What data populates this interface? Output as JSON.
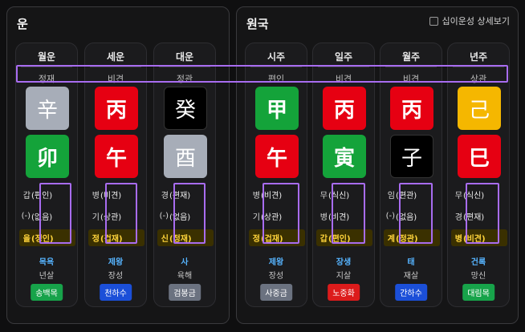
{
  "left_panel": {
    "title": "운",
    "columns": [
      {
        "header": "월운",
        "stem_god": "정재",
        "stem": "辛",
        "stem_color": "gray",
        "branch": "卯",
        "branch_color": "green",
        "hidden": [
          {
            "ch": "갑",
            "god": "(편인)"
          },
          {
            "ch": "(-)",
            "god": "(없음)"
          },
          {
            "ch": "을",
            "god": "(정인)",
            "hl": true
          }
        ],
        "stage": "목욕",
        "sal": "년살",
        "napeum": "송백목",
        "napeum_color": "green"
      },
      {
        "header": "세운",
        "stem_god": "비견",
        "stem": "丙",
        "stem_color": "red",
        "branch": "午",
        "branch_color": "red",
        "hidden": [
          {
            "ch": "병",
            "god": "(비견)"
          },
          {
            "ch": "기",
            "god": "(상관)"
          },
          {
            "ch": "정",
            "god": "(겁재)",
            "hl": true
          }
        ],
        "stage": "제왕",
        "sal": "장성",
        "napeum": "천하수",
        "napeum_color": "blue"
      },
      {
        "header": "대운",
        "stem_god": "정관",
        "stem": "癸",
        "stem_color": "black",
        "branch": "酉",
        "branch_color": "gray",
        "hidden": [
          {
            "ch": "경",
            "god": "(편재)"
          },
          {
            "ch": "(-)",
            "god": "(없음)"
          },
          {
            "ch": "신",
            "god": "(정재)",
            "hl": true
          }
        ],
        "stage": "사",
        "sal": "육해",
        "napeum": "검봉금",
        "napeum_color": "gray"
      }
    ]
  },
  "right_panel": {
    "title": "원국",
    "toggle_label": "십이운성 상세보기",
    "columns": [
      {
        "header": "시주",
        "stem_god": "편인",
        "stem": "甲",
        "stem_color": "green",
        "branch": "午",
        "branch_color": "red",
        "hidden": [
          {
            "ch": "병",
            "god": "(비견)"
          },
          {
            "ch": "기",
            "god": "(상관)"
          },
          {
            "ch": "정",
            "god": "(겁재)",
            "hl": true
          }
        ],
        "stage": "제왕",
        "sal": "장성",
        "napeum": "사중금",
        "napeum_color": "gray"
      },
      {
        "header": "일주",
        "stem_god": "비견",
        "stem": "丙",
        "stem_color": "red",
        "branch": "寅",
        "branch_color": "green",
        "hidden": [
          {
            "ch": "무",
            "god": "(식신)"
          },
          {
            "ch": "병",
            "god": "(비견)"
          },
          {
            "ch": "갑",
            "god": "(편인)",
            "hl": true
          }
        ],
        "stage": "장생",
        "sal": "지살",
        "napeum": "노중화",
        "napeum_color": "red"
      },
      {
        "header": "월주",
        "stem_god": "비견",
        "stem": "丙",
        "stem_color": "red",
        "branch": "子",
        "branch_color": "black",
        "hidden": [
          {
            "ch": "임",
            "god": "(편관)"
          },
          {
            "ch": "(-)",
            "god": "(없음)"
          },
          {
            "ch": "계",
            "god": "(정관)",
            "hl": true
          }
        ],
        "stage": "태",
        "sal": "재살",
        "napeum": "간하수",
        "napeum_color": "blue"
      },
      {
        "header": "년주",
        "stem_god": "상관",
        "stem": "己",
        "stem_color": "yellow",
        "branch": "巳",
        "branch_color": "red",
        "hidden": [
          {
            "ch": "무",
            "god": "(식신)"
          },
          {
            "ch": "경",
            "god": "(편재)"
          },
          {
            "ch": "병",
            "god": "(비견)",
            "hl": true
          }
        ],
        "stage": "건록",
        "sal": "망신",
        "napeum": "대림목",
        "napeum_color": "green"
      }
    ]
  }
}
